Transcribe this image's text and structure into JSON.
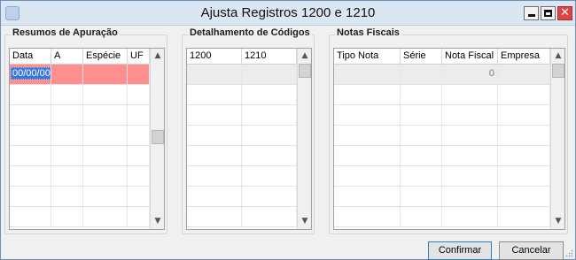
{
  "window": {
    "title": "Ajusta Registros 1200 e 1210",
    "minimize_symbol": "",
    "maximize_symbol": "",
    "close_symbol": "✕"
  },
  "resumos": {
    "title": "Resumos de Apuração",
    "columns": [
      "Data",
      "A",
      "Espécie",
      "UF"
    ],
    "rows": [
      {
        "data": "00/00/00",
        "a": "",
        "especie": "",
        "uf": ""
      }
    ]
  },
  "detalhamento": {
    "title": "Detalhamento de Códigos",
    "columns": [
      "1200",
      "1210"
    ],
    "rows": []
  },
  "notas": {
    "title": "Notas Fiscais",
    "columns": [
      "Tipo Nota",
      "Série",
      "Nota Fiscal",
      "Empresa"
    ],
    "rows": [
      {
        "tipo": "",
        "serie": "",
        "nota": "0",
        "empresa": ""
      }
    ]
  },
  "buttons": {
    "confirmar": "Confirmar",
    "cancelar": "Cancelar"
  },
  "icons": {
    "scroll_up": "▲",
    "scroll_down": "▼"
  }
}
